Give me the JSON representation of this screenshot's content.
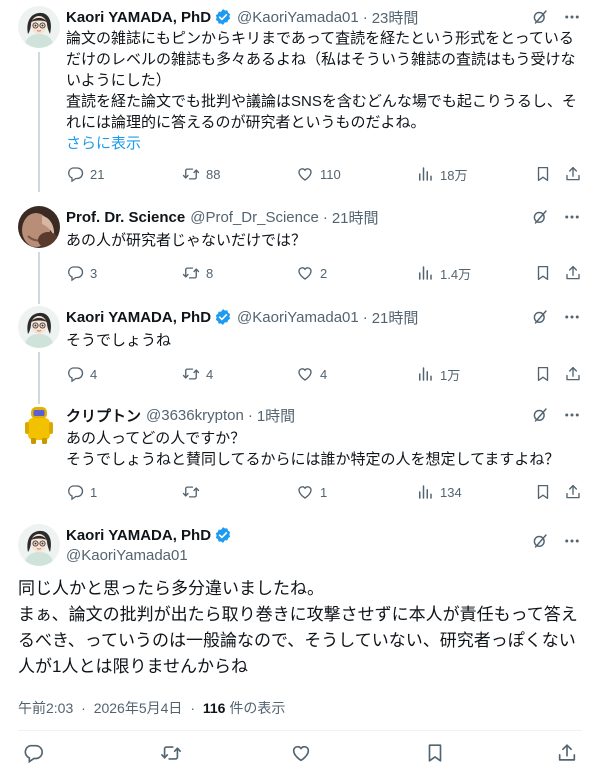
{
  "tweets": [
    {
      "name": "Kaori YAMADA, PhD",
      "handle": "@KaoriYamada01",
      "time": "23時間",
      "lines": [
        "論文の雑誌にもピンからキリまであって査読を経たという形式をとっている",
        "だけのレベルの雑誌も多々あるよね（私はそういう雑誌の査読はもう受けな",
        "いようにした）",
        "査読を経た論文でも批判や議論はSNSを含むどんな場でも起こりうるし、そ",
        "れには論理的に答えるのが研究者というものだよね。"
      ],
      "more": "さらに表示",
      "replies": "21",
      "retweets": "88",
      "likes": "110",
      "views": "18万"
    },
    {
      "name": "Prof. Dr. Science",
      "handle": "@Prof_Dr_Science",
      "time": "21時間",
      "lines": [
        "あの人が研究者じゃないだけでは？"
      ],
      "replies": "3",
      "retweets": "8",
      "likes": "2",
      "views": "1.4万"
    },
    {
      "name": "Kaori YAMADA, PhD",
      "handle": "@KaoriYamada01",
      "time": "21時間",
      "lines": [
        "そうでしょうね"
      ],
      "replies": "4",
      "retweets": "4",
      "likes": "4",
      "views": "1万"
    },
    {
      "name": "クリプトン",
      "handle": "@3636krypton",
      "time": "1時間",
      "lines": [
        "あの人ってどの人ですか？",
        "そうでしょうねと賛同してるからには誰か特定の人を想定してますよね？"
      ],
      "replies": "1",
      "retweets": "",
      "likes": "1",
      "views": "134"
    }
  ],
  "main": {
    "name": "Kaori YAMADA, PhD",
    "handle": "@KaoriYamada01",
    "lines": [
      "同じ人かと思ったら多分違いましたね。",
      "まぁ、論文の批判が出たら取り巻きに攻撃させずに本人が責任もって答え",
      "るべき、っていうのは一般論なので、そうしていない、研究者っぽくない",
      "人が1人とは限りませんからね"
    ],
    "time": "午前2:03",
    "date": "2026年5月4日",
    "views_count": "116",
    "views_label": "件の表示",
    "sep": "·"
  },
  "icons": {
    "grok": "grok-icon",
    "more": "more-icon",
    "reply": "reply-icon",
    "retweet": "retweet-icon",
    "like": "like-icon",
    "views": "views-icon",
    "bookmark": "bookmark-icon",
    "share": "share-icon",
    "verified": "verified-badge-icon"
  },
  "colors": {
    "accent": "#1d9bf0",
    "text": "#0f1419",
    "muted": "#536471",
    "line": "#cfd9de"
  }
}
